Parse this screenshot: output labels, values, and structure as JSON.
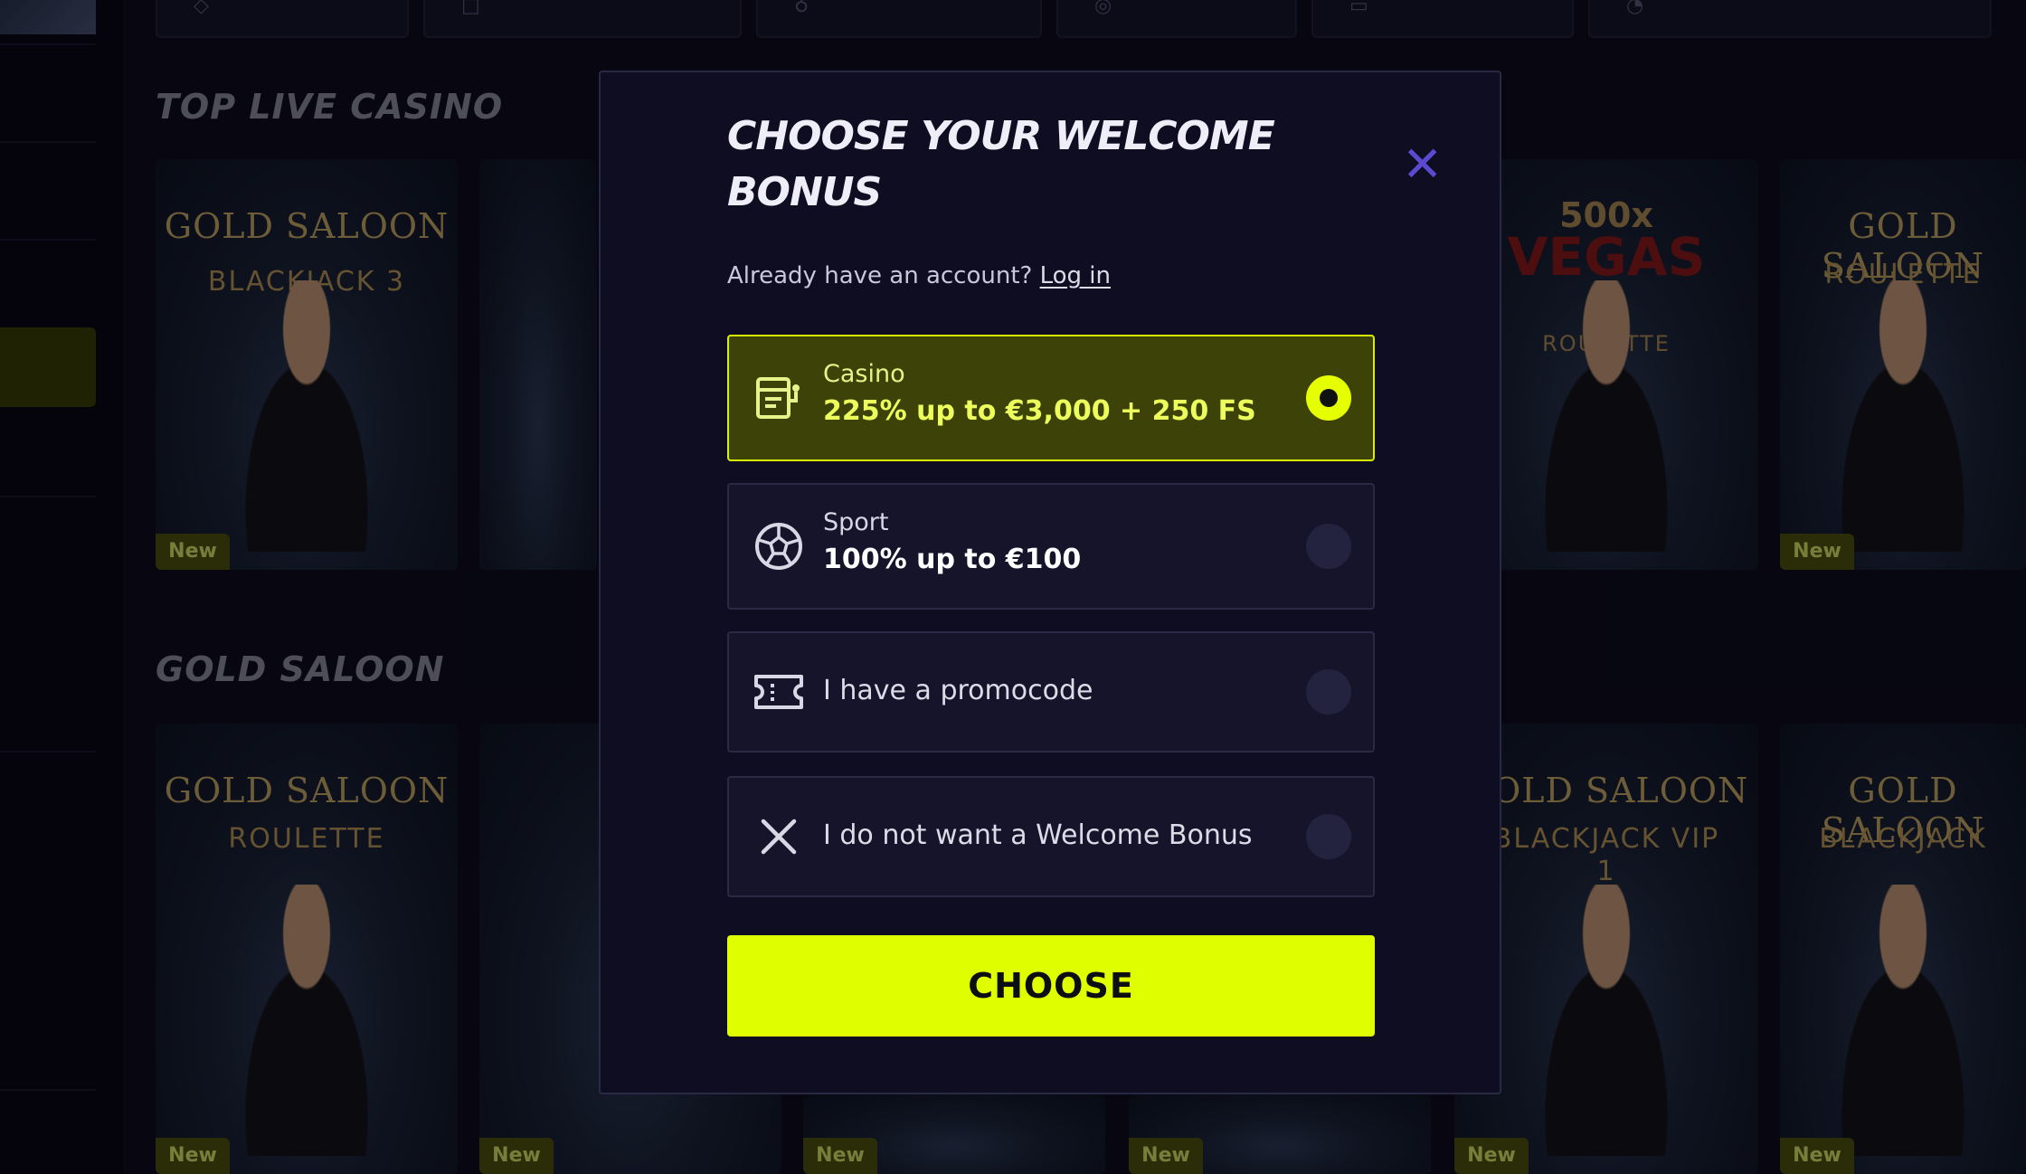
{
  "sections": [
    {
      "title": "TOP LIVE CASINO"
    },
    {
      "title": "GOLD SALOON"
    }
  ],
  "cards": {
    "brand": "GOLD SALOON",
    "badge": "New",
    "blackjack3": "BLACKJACK 3",
    "roulette": "ROULETTE",
    "blackjack_vip1": "BLACKJACK VIP 1",
    "blackjack": "BLACKJACK",
    "vegas_top": "500x",
    "vegas_mid": "VEGAS",
    "vegas_bottom": "ROULETTE"
  },
  "modal": {
    "title": "CHOOSE YOUR WELCOME BONUS",
    "close_icon": "close-x",
    "account_prompt": "Already have an account?",
    "login_link": "Log in",
    "options": [
      {
        "icon": "casino-slot-icon",
        "label": "Casino",
        "value": "225% up to €3,000 + 250 FS",
        "selected": true
      },
      {
        "icon": "soccer-ball-icon",
        "label": "Sport",
        "value": "100% up to €100",
        "selected": false
      },
      {
        "icon": "ticket-icon",
        "label": "I have a promocode",
        "selected": false
      },
      {
        "icon": "close-icon",
        "label": "I do not want a Welcome Bonus",
        "selected": false
      }
    ],
    "submit_label": "CHOOSE"
  },
  "colors": {
    "accent": "#dfff00",
    "selected_bg": "#3d4308",
    "modal_bg": "#0e0d22",
    "close": "#5b4ad0"
  }
}
